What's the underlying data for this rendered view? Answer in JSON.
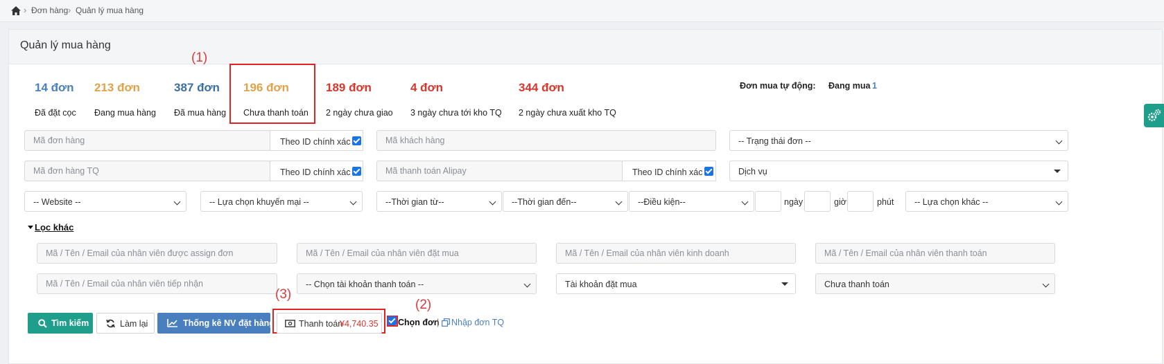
{
  "breadcrumb": {
    "items": [
      "Đơn hàng",
      "Quản lý mua hàng"
    ]
  },
  "page": {
    "title": "Quản lý mua hàng"
  },
  "stats": [
    {
      "count": "14 đơn",
      "label": "Đã đặt cọc",
      "color": "#4a7fc4"
    },
    {
      "count": "213 đơn",
      "label": "Đang mua hàng",
      "color": "#e0a24a"
    },
    {
      "count": "387 đơn",
      "label": "Đã mua hàng",
      "color": "#3a6fa6"
    },
    {
      "count": "196 đơn",
      "label": "Chưa thanh toán",
      "color": "#e0a24a"
    },
    {
      "count": "189 đơn",
      "label": "2 ngày chưa giao",
      "color": "#d9362b"
    },
    {
      "count": "4 đơn",
      "label": "3 ngày chưa tới kho TQ",
      "color": "#d9362b"
    },
    {
      "count": "344 đơn",
      "label": "2 ngày chưa xuất kho TQ",
      "color": "#d9362b"
    }
  ],
  "auto_order": {
    "label": "Đơn mua tự động:",
    "status": "Đang mua",
    "count": "1"
  },
  "annotations": {
    "one": "(1)",
    "two": "(2)",
    "three": "(3)"
  },
  "filters": {
    "order_code_placeholder": "Mã đơn hàng",
    "exact_id_label": "Theo ID chính xác",
    "customer_code_placeholder": "Mã khách hàng",
    "order_status": "-- Trạng thái đơn --",
    "order_code_tq_placeholder": "Mã đơn hàng TQ",
    "alipay_placeholder": "Mã thanh toán Alipay",
    "service": "Dịch vụ",
    "website": "-- Website --",
    "promotion": "-- Lựa chọn khuyến mại --",
    "time_from": "--Thời gian từ--",
    "time_to": "--Thời gian đến--",
    "condition": "--Điều kiện--",
    "unit_day": "ngày",
    "unit_hour": "giờ",
    "unit_minute": "phút",
    "other_choice": "-- Lựa chọn khác --"
  },
  "more_filters": {
    "toggle": "Lọc khác",
    "assigned_staff_placeholder": "Mã / Tên / Email của nhân viên được assign đơn",
    "buyer_staff_placeholder": "Mã / Tên / Email của nhân viên đặt mua",
    "sales_staff_placeholder": "Mã / Tên / Email của nhân viên kinh doanh",
    "payment_staff_placeholder": "Mã / Tên / Email của nhân viên thanh toán",
    "receiver_staff_placeholder": "Mã / Tên / Email của nhân viên tiếp nhận",
    "payment_account": "-- Chọn tài khoản thanh toán --",
    "buy_account": "Tài khoản đặt mua",
    "payment_status": "Chưa thanh toán"
  },
  "actions": {
    "search": "Tìm kiếm",
    "reset": "Làm lại",
    "stats_staff": "Thống kê NV đặt hàng",
    "pay_label": "Thanh toán",
    "pay_amount": "¥4,740.35",
    "select_orders": "Chọn đơn",
    "separator": "|",
    "import_tq": "Nhập đơn TQ"
  },
  "colors": {
    "red_annot": "#e0383b",
    "green": "#1f9e8c",
    "blue": "#4a7fbf"
  }
}
